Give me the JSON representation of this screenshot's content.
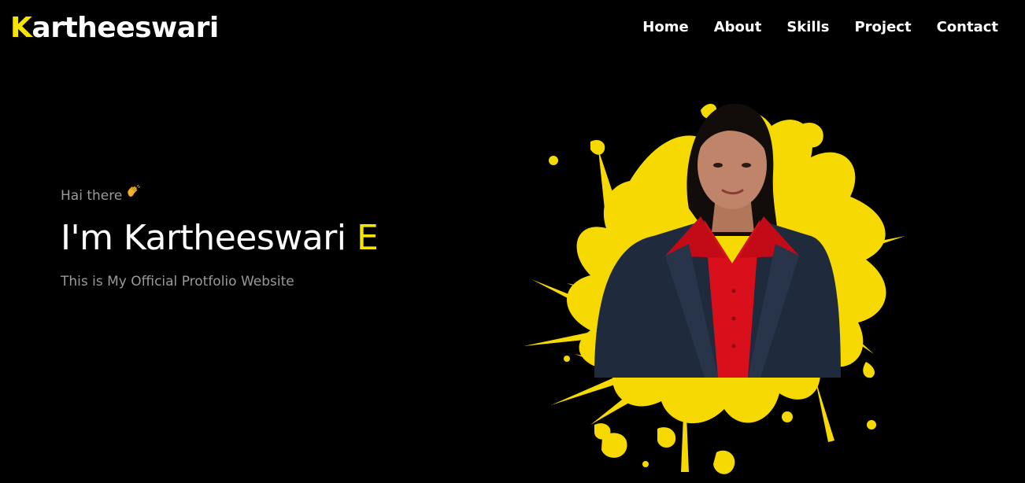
{
  "header": {
    "brand_initial": "K",
    "brand_rest": "artheeswari"
  },
  "nav": {
    "items": [
      {
        "label": "Home"
      },
      {
        "label": "About"
      },
      {
        "label": "Skills"
      },
      {
        "label": "Project"
      },
      {
        "label": "Contact"
      }
    ]
  },
  "hero": {
    "greeting": "Hai there",
    "greeting_icon": "waving-hand-icon",
    "headline_main": "I'm Kartheeswari ",
    "headline_initial": "E",
    "subtitle": "This is My Official Protfolio Website"
  },
  "colors": {
    "background": "#000000",
    "accent": "#f6e400",
    "splash": "#f5d900",
    "muted_text": "#9a9a9a",
    "blazer": "#1f2a3d",
    "shirt": "#d9101c"
  }
}
